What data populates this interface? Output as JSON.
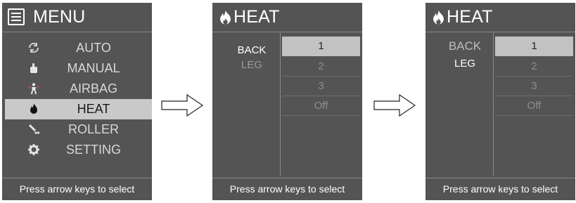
{
  "screen1": {
    "title": "MENU",
    "items": [
      {
        "label": "AUTO",
        "icon": "refresh-icon"
      },
      {
        "label": "MANUAL",
        "icon": "hand-icon"
      },
      {
        "label": "AIRBAG",
        "icon": "airbag-person-icon"
      },
      {
        "label": "HEAT",
        "icon": "flame-icon",
        "selected": true
      },
      {
        "label": "ROLLER",
        "icon": "roller-icon"
      },
      {
        "label": "SETTING",
        "icon": "gear-icon"
      }
    ],
    "footer": "Press arrow keys to select"
  },
  "screen2": {
    "title": "HEAT",
    "categories": [
      "BACK",
      "LEG"
    ],
    "active_category": "BACK",
    "options": [
      "1",
      "2",
      "3",
      "Off"
    ],
    "selected_option": "1",
    "footer": "Press arrow keys to select"
  },
  "screen3": {
    "title": "HEAT",
    "categories": [
      "BACK",
      "LEG"
    ],
    "active_category": "LEG",
    "options": [
      "1",
      "2",
      "3",
      "Off"
    ],
    "selected_option": "1",
    "footer": "Press arrow keys to select"
  },
  "colors": {
    "screen_bg": "#545454",
    "highlight": "#c9c9c9",
    "text": "#ffffff",
    "dim_text": "#9a9a9a"
  }
}
